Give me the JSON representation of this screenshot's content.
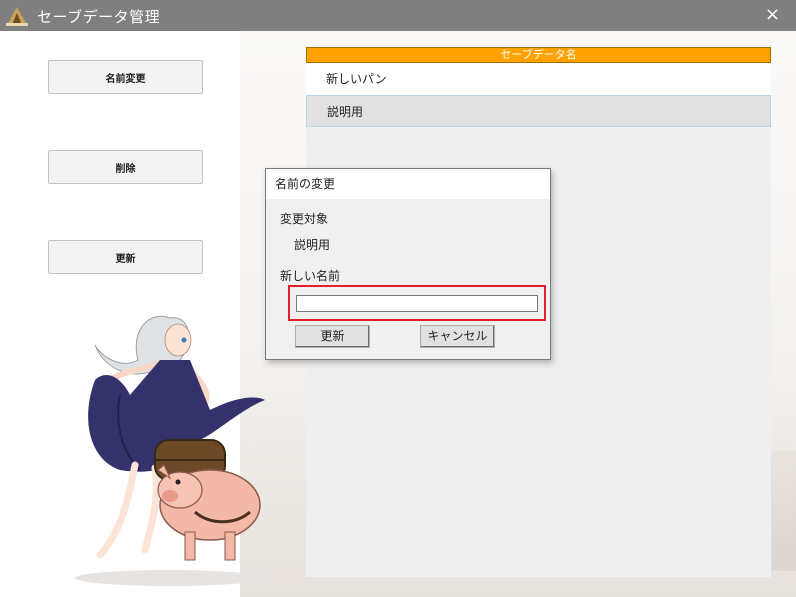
{
  "window": {
    "title": "セーブデータ管理",
    "close_icon": "×",
    "app_icon": "app-logo-icon"
  },
  "sidebar": {
    "rename_label": "名前変更",
    "delete_label": "削除",
    "update_label": "更新"
  },
  "list": {
    "header": "セーブデータ名",
    "items": [
      {
        "label": "新しいパン",
        "selected": false
      },
      {
        "label": "説明用",
        "selected": true
      }
    ],
    "header_color": "#ffa200"
  },
  "dialog": {
    "title": "名前の変更",
    "target_label": "変更対象",
    "target_value": "説明用",
    "new_name_label": "新しい名前",
    "new_name_value": "",
    "update_button": "更新",
    "cancel_button": "キャンセル",
    "highlight_color": "#e0202c"
  }
}
